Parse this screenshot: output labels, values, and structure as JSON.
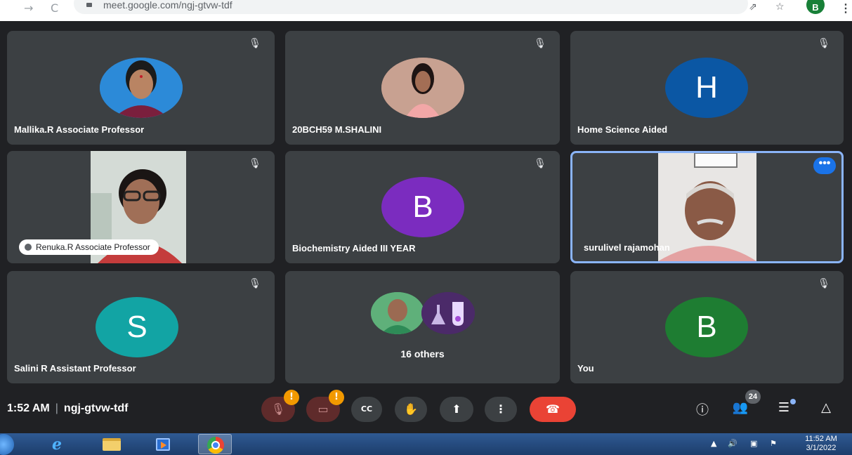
{
  "browser": {
    "back_glyph": "→",
    "reload_glyph": "C",
    "url": "meet.google.com/ngj-gtvw-tdf",
    "share_glyph": "⇗",
    "star_glyph": "☆",
    "profile_initial": "B",
    "menu_glyph": "⋮"
  },
  "tiles": [
    {
      "name": "Mallika.R Associate Professor",
      "avatar": "photo",
      "avatar_color": "#2c8ad8",
      "muted": true
    },
    {
      "name": "20BCH59 M.SHALINI",
      "avatar": "photo",
      "avatar_color": "#b8877a",
      "muted": true
    },
    {
      "name": "Home Science Aided",
      "avatar": "H",
      "avatar_color": "#0b57a4",
      "muted": true
    },
    {
      "name": "Renuka.R Associate Professor",
      "avatar": "video",
      "muted": true
    },
    {
      "name": "Biochemistry Aided III YEAR",
      "avatar": "B",
      "avatar_color": "#7b2cbf",
      "muted": true
    },
    {
      "name": "surulivel rajamohan",
      "avatar": "video",
      "muted": false,
      "active_speaker": true,
      "more_glyph": "•••"
    },
    {
      "name": "Salini R Assistant Professor",
      "avatar": "S",
      "avatar_color": "#12a4a4",
      "muted": true
    },
    {
      "name": "16 others",
      "avatar": "group",
      "muted": false
    },
    {
      "name": "You",
      "avatar": "B",
      "avatar_color": "#1e7d32",
      "muted": true
    }
  ],
  "mute_glyph": "🎙",
  "control_bar": {
    "time": "1:52 AM",
    "separator": "|",
    "meeting_code": "ngj-gtvw-tdf",
    "mic_glyph": "🎙",
    "camera_glyph": "▭",
    "alert_glyph": "!",
    "captions_glyph": "CC",
    "hand_glyph": "✋",
    "present_glyph": "⬆",
    "more_glyph": "⋮",
    "end_call_glyph": "☎",
    "info_glyph": "ⓘ",
    "people_glyph": "👥",
    "participant_count": "24",
    "chat_glyph": "☰",
    "activities_glyph": "△"
  },
  "taskbar": {
    "ie_glyph": "e",
    "tray_up": "▲",
    "volume": "🔊",
    "network": "▣",
    "flag": "⚑",
    "time": "11:52 AM",
    "date": "3/1/2022"
  },
  "colors": {
    "meet_background": "#202124",
    "tile_background": "#3c4043",
    "active_border": "#8ab4f8",
    "end_call": "#ea4335",
    "alert": "#f29900"
  }
}
